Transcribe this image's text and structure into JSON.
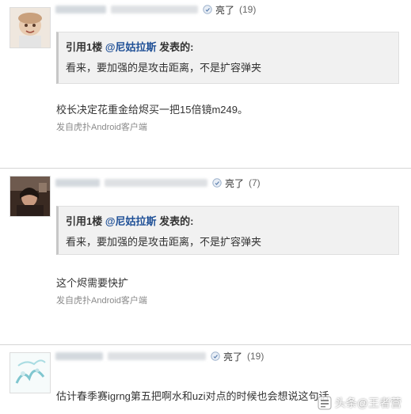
{
  "posts": [
    {
      "like_label": "亮了",
      "like_count": "(19)",
      "quote": {
        "prefix": "引用1楼 ",
        "user": "@尼姑拉斯",
        "suffix": " 发表的:",
        "text": "看来，要加强的是攻击距离，不是扩容弹夹"
      },
      "content": "校长决定花重金给烬买一把15倍镜m249。",
      "source": "发自虎扑Android客户端"
    },
    {
      "like_label": "亮了",
      "like_count": "(7)",
      "quote": {
        "prefix": "引用1楼 ",
        "user": "@尼姑拉斯",
        "suffix": " 发表的:",
        "text": "看来，要加强的是攻击距离，不是扩容弹夹"
      },
      "content": "这个烬需要快扩",
      "source": "发自虎扑Android客户端"
    },
    {
      "like_label": "亮了",
      "like_count": "(19)",
      "content": "估计春季赛igrng第五把啊水和uzi对点的时候也会想说这句话"
    }
  ],
  "watermark": {
    "text": "头条@王者营"
  },
  "colors": {
    "quote_link": "#1e4f96",
    "quote_bg": "#f1f1f1",
    "source": "#8a8a8a"
  }
}
